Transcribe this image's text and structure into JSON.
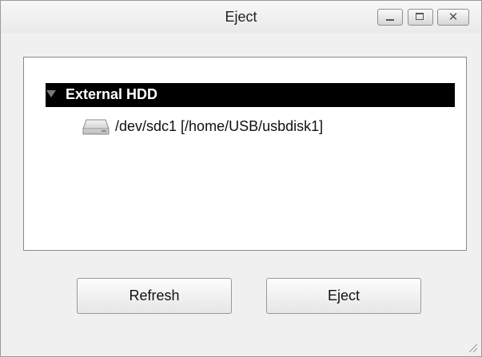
{
  "window": {
    "title": "Eject"
  },
  "titlebar_buttons": {
    "minimize_icon": "minimize-icon",
    "maximize_icon": "maximize-icon",
    "close_icon": "close-icon",
    "close_glyph": "✕"
  },
  "tree": {
    "parent": {
      "label": "External HDD",
      "expanded": true
    },
    "children": [
      {
        "label": "/dev/sdc1 [/home/USB/usbdisk1]",
        "icon": "drive-icon"
      }
    ]
  },
  "buttons": {
    "refresh_label": "Refresh",
    "eject_label": "Eject"
  },
  "colors": {
    "selection_bg": "#000000",
    "selection_fg": "#ffffff",
    "window_bg": "#f0f0f0"
  }
}
